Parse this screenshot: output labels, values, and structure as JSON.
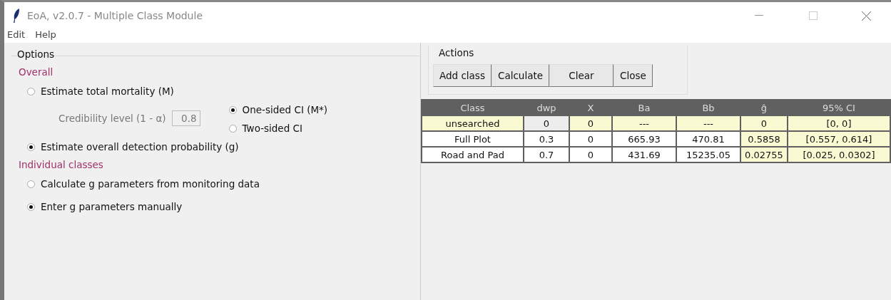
{
  "window": {
    "title": "EoA, v2.0.7 - Multiple Class Module"
  },
  "menu": [
    "Edit",
    "Help"
  ],
  "options": {
    "title": "Options",
    "overall_heading": "Overall",
    "mortality": {
      "label": "Estimate total mortality (M)",
      "selected": false
    },
    "credibility": {
      "label": "Credibility level (1 - α)",
      "value": "0.8",
      "disabled": true
    },
    "ci_options": [
      {
        "label": "One-sided CI (M*)",
        "selected": true
      },
      {
        "label": "Two-sided CI",
        "selected": false
      }
    ],
    "detection": {
      "label": "Estimate overall detection probability (g)",
      "selected": true
    },
    "individual_heading": "Individual classes",
    "individual_options": [
      {
        "label": "Calculate g parameters from monitoring data",
        "selected": false
      },
      {
        "label": "Enter g parameters manually",
        "selected": true
      }
    ]
  },
  "actions": {
    "title": "Actions",
    "buttons": [
      "Add class",
      "Calculate",
      "Clear",
      "Close"
    ]
  },
  "table": {
    "columns": [
      "Class",
      "dwp",
      "X",
      "Ba",
      "Bb",
      "ĝ",
      "95% CI"
    ],
    "rows": [
      [
        {
          "text": "unsearched",
          "kind": "computed"
        },
        {
          "text": "0",
          "kind": "locked"
        },
        {
          "text": "0",
          "kind": "computed"
        },
        {
          "text": "---",
          "kind": "computed"
        },
        {
          "text": "---",
          "kind": "computed"
        },
        {
          "text": "0",
          "kind": "computed"
        },
        {
          "text": "[0, 0]",
          "kind": "computed"
        }
      ],
      [
        {
          "text": "Full Plot",
          "kind": "input"
        },
        {
          "text": "0.3",
          "kind": "input"
        },
        {
          "text": "0",
          "kind": "input"
        },
        {
          "text": "665.93",
          "kind": "input"
        },
        {
          "text": "470.81",
          "kind": "input"
        },
        {
          "text": "0.5858",
          "kind": "computed"
        },
        {
          "text": "[0.557, 0.614]",
          "kind": "computed"
        }
      ],
      [
        {
          "text": "Road and Pad",
          "kind": "input"
        },
        {
          "text": "0.7",
          "kind": "input"
        },
        {
          "text": "0",
          "kind": "input"
        },
        {
          "text": "431.69",
          "kind": "input"
        },
        {
          "text": "15235.05",
          "kind": "input"
        },
        {
          "text": "0.02755",
          "kind": "computed"
        },
        {
          "text": "[0.025, 0.0302]",
          "kind": "computed"
        }
      ]
    ]
  }
}
